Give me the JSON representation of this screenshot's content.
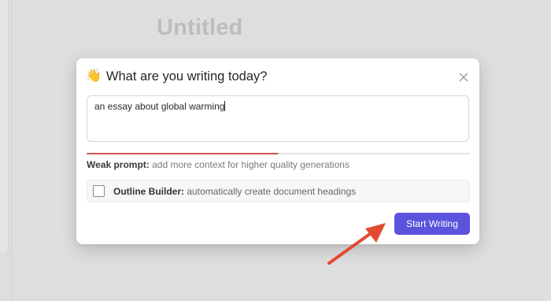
{
  "background": {
    "doc_title": "Untitled"
  },
  "modal": {
    "title": "What are you writing today?",
    "wave_emoji": "👋",
    "close_icon": "close-icon",
    "prompt_value": "an essay about global warming",
    "strength_fraction": 0.5,
    "strength_color": "#d9534f",
    "hint_strong": "Weak prompt:",
    "hint_text": " add more context for higher quality generations",
    "outline": {
      "checked": false,
      "label_strong": "Outline Builder:",
      "label_text": " automatically create document headings"
    },
    "start_button": "Start Writing",
    "accent_color": "#5a53dd"
  },
  "annotation": {
    "arrow_color": "#e24a33"
  }
}
